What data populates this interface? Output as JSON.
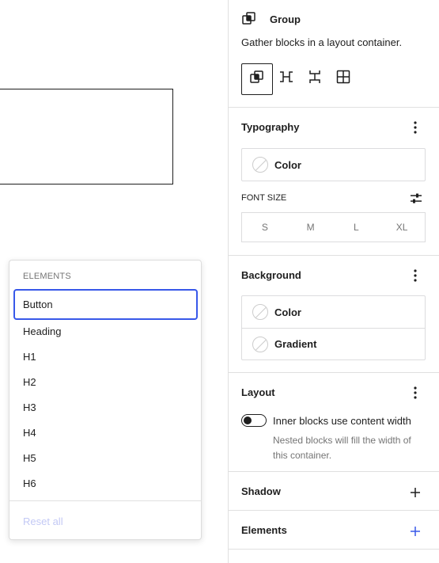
{
  "block": {
    "title": "Group",
    "description": "Gather blocks in a layout container.",
    "icon": "group-icon",
    "variations": [
      {
        "name": "group",
        "icon": "group-icon",
        "selected": true
      },
      {
        "name": "row",
        "icon": "row-icon",
        "selected": false
      },
      {
        "name": "stack",
        "icon": "stack-icon",
        "selected": false
      },
      {
        "name": "grid",
        "icon": "grid-icon",
        "selected": false
      }
    ]
  },
  "elements_dropdown": {
    "heading": "ELEMENTS",
    "items": [
      "Button",
      "Heading",
      "H1",
      "H2",
      "H3",
      "H4",
      "H5",
      "H6"
    ],
    "active_item": "Button",
    "reset_label": "Reset all"
  },
  "typography": {
    "title": "Typography",
    "color_label": "Color",
    "font_size_label": "FONT SIZE",
    "font_sizes": [
      "S",
      "M",
      "L",
      "XL"
    ]
  },
  "background": {
    "title": "Background",
    "color_label": "Color",
    "gradient_label": "Gradient"
  },
  "layout": {
    "title": "Layout",
    "toggle_label": "Inner blocks use content width",
    "toggle_help": "Nested blocks will fill the width of this container.",
    "toggle_on": false
  },
  "shadow": {
    "title": "Shadow"
  },
  "elements_panel": {
    "title": "Elements"
  },
  "colors": {
    "accent": "#3858e9",
    "text": "#1e1e1e",
    "muted": "#757575",
    "border": "#e0e0e0"
  }
}
